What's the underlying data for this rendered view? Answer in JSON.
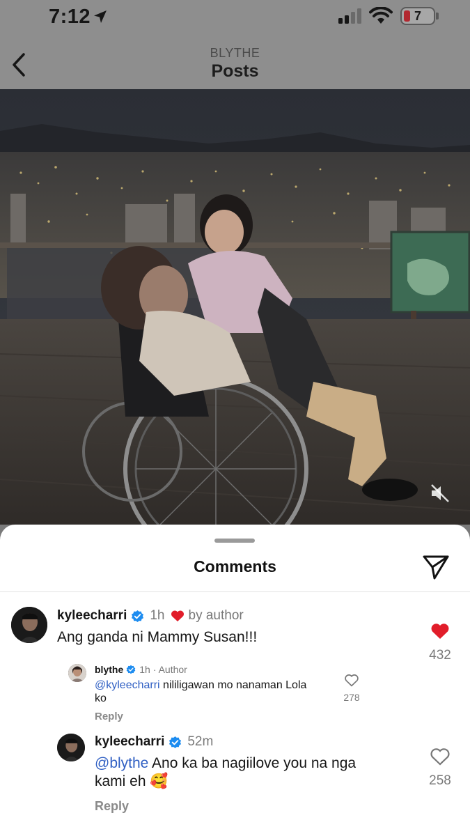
{
  "status_bar": {
    "time": "7:12",
    "battery": "7"
  },
  "nav": {
    "subtitle": "BLYTHE",
    "title": "Posts"
  },
  "comments": {
    "title": "Comments",
    "items": [
      {
        "username": "kyleecharri",
        "verified": true,
        "time": "1h",
        "liked_by_author_label": "by author",
        "text": "Ang ganda ni Mammy Susan!!!",
        "likes": "432",
        "liked": true,
        "replies": [
          {
            "username": "blythe",
            "verified": true,
            "time": "1h",
            "author_tag": "· Author",
            "mention": "@kyleecharri",
            "text_line1": " nililigawan mo nanaman Lola",
            "text_line2": "ko",
            "likes": "278",
            "reply_label": "Reply"
          },
          {
            "username": "kyleecharri",
            "verified": true,
            "time": "52m",
            "mention": "@blythe",
            "text_line1": " Ano ka ba nagiilove you na nga",
            "text_line2": "kami eh 🥰",
            "likes": "258",
            "reply_label": "Reply"
          }
        ]
      }
    ]
  },
  "colors": {
    "accent_red": "#e11d2a",
    "mention_blue": "#2f5fc3",
    "verified_blue": "#1d8cf0"
  }
}
